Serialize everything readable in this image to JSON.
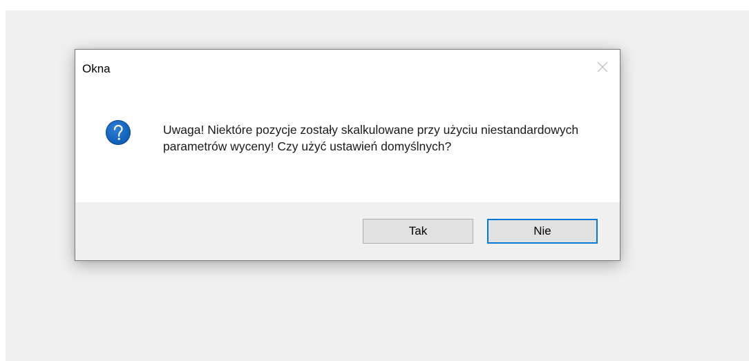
{
  "dialog": {
    "title": "Okna",
    "close_icon": "close-icon",
    "message": "Uwaga! Niektóre pozycje zostały skalkulowane przy użyciu niestandardowych parametrów wyceny! Czy użyć ustawień domyślnych?",
    "icon": "question-icon",
    "buttons": {
      "yes": "Tak",
      "no": "Nie"
    },
    "default_button": "no"
  },
  "colors": {
    "backdrop": "#f0f0f0",
    "dialog_background": "#ffffff",
    "footer_background": "#f0f0f0",
    "icon_blue": "#1464bd",
    "focus_border": "#0078d7",
    "button_face": "#e1e1e1"
  }
}
